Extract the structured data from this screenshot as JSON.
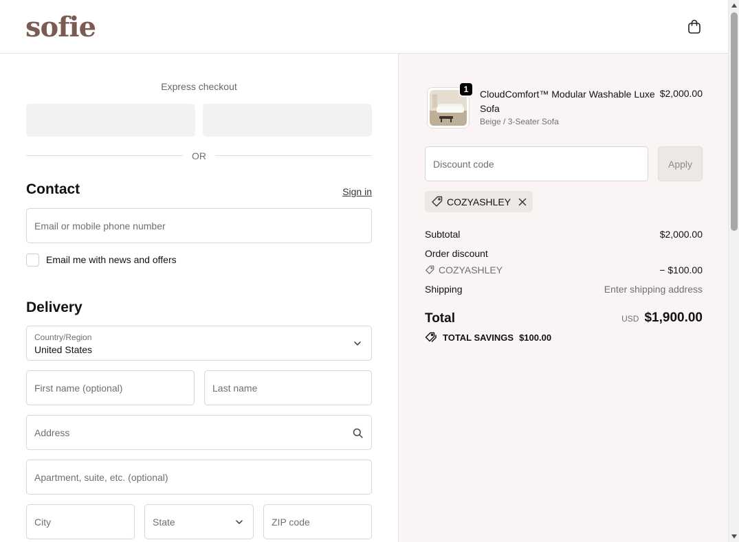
{
  "header": {
    "logo": "sofie",
    "cart_icon": "shopping-bag-icon"
  },
  "express": {
    "title": "Express checkout",
    "or": "OR"
  },
  "contact": {
    "title": "Contact",
    "sign_in": "Sign in",
    "email_placeholder": "Email or mobile phone number",
    "newsletter_label": "Email me with news and offers"
  },
  "delivery": {
    "title": "Delivery",
    "country_label": "Country/Region",
    "country_value": "United States",
    "first_name_placeholder": "First name (optional)",
    "last_name_placeholder": "Last name",
    "address_placeholder": "Address",
    "apartment_placeholder": "Apartment, suite, etc. (optional)",
    "city_placeholder": "City",
    "state_label": "State",
    "zip_placeholder": "ZIP code"
  },
  "summary": {
    "item": {
      "quantity": "1",
      "name": "CloudComfort™ Modular Washable Luxe Sofa",
      "variant": "Beige / 3-Seater Sofa",
      "price": "$2,000.00"
    },
    "discount_placeholder": "Discount code",
    "apply_label": "Apply",
    "applied_code": "COZYASHLEY",
    "subtotal_label": "Subtotal",
    "subtotal_value": "$2,000.00",
    "order_discount_label": "Order discount",
    "discount_code": "COZYASHLEY",
    "discount_value": "− $100.00",
    "shipping_label": "Shipping",
    "shipping_value": "Enter shipping address",
    "total_label": "Total",
    "currency": "USD",
    "total_value": "$1,900.00",
    "savings_label": "TOTAL SAVINGS",
    "savings_value": "$100.00"
  },
  "colors": {
    "brand": "#7a5c53",
    "summary_bg": "#faf5f4",
    "chip_bg": "#ede7e5"
  }
}
